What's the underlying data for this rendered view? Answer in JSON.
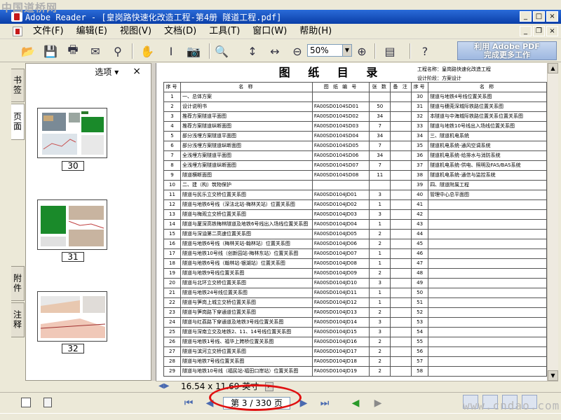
{
  "watermark": "中国道桥网",
  "window": {
    "title": "Adobe Reader - [皇岗路快速化改造工程-第4册 隧道工程.pdf]",
    "min": "_",
    "max": "□",
    "close": "×"
  },
  "doc_controls": {
    "min": "_",
    "restore": "❐",
    "close": "×"
  },
  "menu": [
    "文件(F)",
    "编辑(E)",
    "视图(V)",
    "文档(D)",
    "工具(T)",
    "窗口(W)",
    "帮助(H)"
  ],
  "toolbar": {
    "zoom": "50%",
    "promo_line1": "利用 Adobe PDF",
    "promo_line2": "完成更多工作"
  },
  "left_tabs": [
    "书签",
    "页面",
    "附件",
    "注释"
  ],
  "panel": {
    "options": "选项 ▾",
    "close": "×",
    "thumbnails": [
      "30",
      "31",
      "32"
    ]
  },
  "sheet": {
    "title": "图 纸 目 录",
    "project_label": "工程名称：皇岗路快速化改造工程",
    "stage_label": "设计阶段：方案设计",
    "headers": [
      "序号",
      "名  称",
      "图 纸 编 号",
      "张 数",
      "备 注",
      "序号",
      "名  称"
    ],
    "rows": [
      [
        "1",
        "一、总体方案",
        "",
        "",
        "",
        "30",
        "隧道与地铁4号线位置关系图"
      ],
      [
        "2",
        "设计说明书",
        "FA00SD0104SD01",
        "50",
        "",
        "31",
        "隧道与穗莞深城际铁路位置关系图"
      ],
      [
        "3",
        "推荐方案隧道平面图",
        "FA00SD0104SD02",
        "34",
        "",
        "32",
        "本隧道与中海城际铁路位置关系位置关系图"
      ],
      [
        "4",
        "推荐方案隧道纵断面图",
        "FA00SD0104SD03",
        "7",
        "",
        "33",
        "隧道与地铁10号线出入场线位置关系图"
      ],
      [
        "5",
        "部分浅埋方案隧道平面图",
        "FA00SD0104SD04",
        "34",
        "",
        "34",
        "三、隧道机电系统"
      ],
      [
        "6",
        "部分浅埋方案隧道纵断面图",
        "FA00SD0104SD05",
        "7",
        "",
        "35",
        "隧道机电系统-通风空调系统"
      ],
      [
        "7",
        "全浅埋方案隧道平面图",
        "FA00SD0104SD06",
        "34",
        "",
        "36",
        "隧道机电系统-给排水与消防系统"
      ],
      [
        "8",
        "全浅埋方案隧道纵断面图",
        "FA00SD0104SD07",
        "7",
        "",
        "37",
        "隧道机电系统-供电、照明及FAS/BAS系统"
      ],
      [
        "9",
        "隧道横断面图",
        "FA00SD0104SD08",
        "11",
        "",
        "38",
        "隧道机电系统-通信与监控系统"
      ],
      [
        "10",
        "二、建（构）筑物保护",
        "",
        "",
        "",
        "39",
        "四、隧道附属工程"
      ],
      [
        "11",
        "隧道与民乐立交桥位置关系图",
        "FA00SD0104JD01",
        "3",
        "",
        "40",
        "管理中心总平面图"
      ],
      [
        "12",
        "隧道与地铁6号线（深法北站-梅林关站）位置关系图",
        "FA00SD0104JD02",
        "1",
        "",
        "41",
        ""
      ],
      [
        "13",
        "隧道与梅观立交桥位置关系图",
        "FA00SD0104JD03",
        "3",
        "",
        "42",
        ""
      ],
      [
        "14",
        "隧道与厦深高铁梅林隧道及地铁6号线出入场线位置关系图",
        "FA00SD0104JD04",
        "1",
        "",
        "43",
        ""
      ],
      [
        "15",
        "隧道与深油第二高速位置关系图",
        "FA00SD0104JD05",
        "2",
        "",
        "44",
        ""
      ],
      [
        "16",
        "隧道与地铁6号线（梅林关站-翰林站）位置关系图",
        "FA00SD0104JD06",
        "2",
        "",
        "45",
        ""
      ],
      [
        "17",
        "隧道与地铁10号线（创新园站-梅林东站）位置关系图",
        "FA00SD0104JD07",
        "1",
        "",
        "46",
        ""
      ],
      [
        "18",
        "隧道与地铁6号线（翰林站-银湖站）位置关系图",
        "FA00SD0104JD08",
        "1",
        "",
        "47",
        ""
      ],
      [
        "19",
        "隧道与地铁9号线位置关系图",
        "FA00SD0104JD09",
        "2",
        "",
        "48",
        ""
      ],
      [
        "20",
        "隧道与北环立交桥位置关系图",
        "FA00SD0104JD10",
        "3",
        "",
        "49",
        ""
      ],
      [
        "21",
        "隧道与地铁24号线位置关系图",
        "FA00SD0104JD11",
        "1",
        "",
        "50",
        ""
      ],
      [
        "22",
        "隧道与笋岗上城立交桥位置关系图",
        "FA00SD0104JD12",
        "1",
        "",
        "51",
        ""
      ],
      [
        "23",
        "隧道与笋岗路下穿通道位置关系图",
        "FA00SD0104JD13",
        "2",
        "",
        "52",
        ""
      ],
      [
        "24",
        "隧道与红荔路下穿通道及地铁3号线位置关系图",
        "FA00SD0104JD14",
        "3",
        "",
        "53",
        ""
      ],
      [
        "25",
        "隧道与深南立交及地铁2、11、14号线位置关系图",
        "FA00SD0104JD15",
        "3",
        "",
        "54",
        ""
      ],
      [
        "26",
        "隧道与地铁1号线、福华上跨桥位置关系图",
        "FA00SD0104JD16",
        "2",
        "",
        "55",
        ""
      ],
      [
        "27",
        "隧道与滨河立交桥位置关系图",
        "FA00SD0104JD17",
        "2",
        "",
        "56",
        ""
      ],
      [
        "28",
        "隧道与地铁7号线位置关系图",
        "FA00SD0104JD18",
        "2",
        "",
        "57",
        ""
      ],
      [
        "29",
        "隧道与地铁10号线（福民站-福田口岸站）位置关系图",
        "FA00SD0104JD19",
        "2",
        "",
        "58",
        ""
      ]
    ]
  },
  "page_size": "16.54 x 11.69 英寸",
  "status": {
    "page": "第 3 / 330 页",
    "first": "⏮",
    "prev": "◀",
    "next": "▶",
    "last": "⏭",
    "back": "◀",
    "forward": "▶"
  },
  "site_brand": "www.cndao.com"
}
